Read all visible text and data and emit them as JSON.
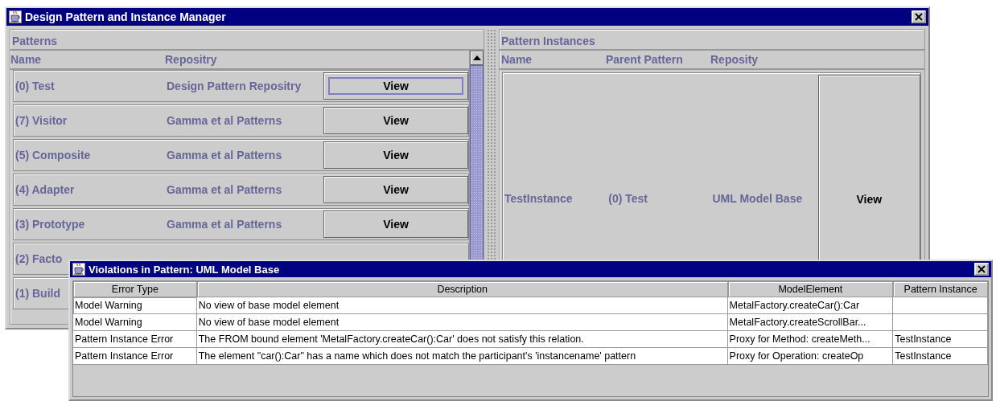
{
  "window": {
    "title": "Design Pattern and Instance Manager"
  },
  "patterns": {
    "title": "Patterns",
    "columns": [
      "Name",
      "Repositry"
    ],
    "rows": [
      {
        "name": "(0) Test",
        "repository": "Design Pattern Repositry",
        "button": "View",
        "focused": true
      },
      {
        "name": "(7) Visitor",
        "repository": "Gamma et al Patterns",
        "button": "View",
        "focused": false
      },
      {
        "name": "(5) Composite",
        "repository": "Gamma et al Patterns",
        "button": "View",
        "focused": false
      },
      {
        "name": "(4) Adapter",
        "repository": "Gamma et al Patterns",
        "button": "View",
        "focused": false
      },
      {
        "name": "(3) Prototype",
        "repository": "Gamma et al Patterns",
        "button": "View",
        "focused": false
      },
      {
        "name": "(2) Facto",
        "focused": false
      },
      {
        "name": "(1) Build",
        "focused": false
      }
    ]
  },
  "instances": {
    "title": "Pattern Instances",
    "columns": [
      "Name",
      "Parent Pattern",
      "Reposity"
    ],
    "rows": [
      {
        "name": "TestInstance",
        "parent": "(0) Test",
        "repository": "UML Model Base",
        "button": "View"
      }
    ]
  },
  "dialog": {
    "title": "Violations in Pattern: UML Model Base",
    "columns": [
      "Error Type",
      "Description",
      "ModelElement",
      "Pattern Instance"
    ],
    "rows": [
      {
        "cells": [
          "Model Warning",
          "No view of base model element",
          "MetalFactory.createCar():Car",
          ""
        ],
        "focused": true
      },
      {
        "cells": [
          "Model Warning",
          "No view of base model element",
          "MetalFactory.createScrollBar...",
          ""
        ],
        "focused": false
      },
      {
        "cells": [
          "Pattern Instance Error",
          "The FROM bound element 'MetalFactory.createCar():Car' does not satisfy this relation.",
          "Proxy for Method: createMeth...",
          "TestInstance"
        ],
        "focused": false
      },
      {
        "cells": [
          "Pattern Instance Error",
          "The element \"car():Car\" has a name which does not match the participant's 'instancename' pattern",
          "Proxy for Operation: createOp",
          "TestInstance"
        ],
        "focused": false
      }
    ]
  }
}
